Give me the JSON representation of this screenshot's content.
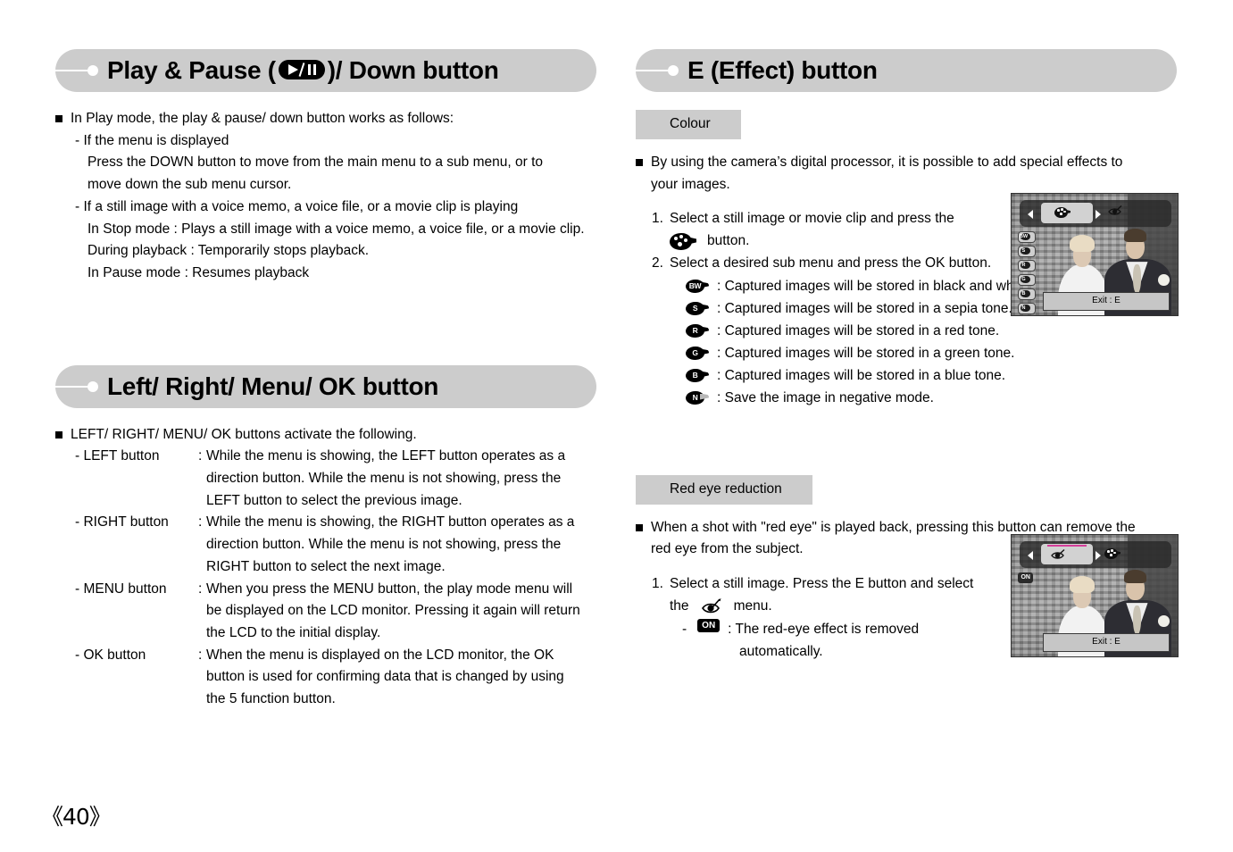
{
  "page": {
    "number": "《40》",
    "background": "#ffffff",
    "heading_fill": "#cccccc",
    "caption_fill": "#cccccc"
  },
  "left_column": {
    "section1": {
      "title_before": "Play & Pause (",
      "icon": "play-pause-icon",
      "title_after": ")/ Down button",
      "bullets": [
        {
          "marker": "square",
          "text": "In Play mode, the play & pause/ down button works as follows:"
        }
      ],
      "lines": [
        "- If the menu is displayed",
        "Press the DOWN button to move from the main menu to a sub menu, or to",
        "move down the sub menu cursor.",
        "- If a still image with a voice memo, a voice file, or a movie clip is playing",
        "In Stop mode : Plays a still image with a voice memo, a voice file, or a movie clip.",
        "During playback : Temporarily stops playback.",
        "In Pause mode : Resumes playback"
      ]
    },
    "section2": {
      "title": "Left/ Right/ Menu/ OK button",
      "bullet": "LEFT/ RIGHT/ MENU/ OK buttons activate the following.",
      "definitions": [
        {
          "label": "- LEFT button",
          "colon": ":",
          "lines": [
            "While the menu is showing, the LEFT button operates as a",
            "direction button. While the menu is not showing, press the",
            "LEFT button to select the previous image."
          ]
        },
        {
          "label": "- RIGHT button",
          "colon": ":",
          "lines": [
            "While the menu is showing, the RIGHT button operates as a",
            "direction button. While the menu is not showing, press the",
            "RIGHT button to select the next image."
          ]
        },
        {
          "label": "- MENU button",
          "colon": ":",
          "lines": [
            "When you press the MENU button, the play mode menu will",
            "be displayed on the LCD monitor. Pressing it again will return",
            "the LCD to the initial display."
          ]
        },
        {
          "label": "- OK button",
          "colon": ":",
          "lines": [
            "When the menu is displayed on the LCD monitor, the OK",
            "button is used for confirming data that is changed by using",
            "the 5 function button."
          ]
        }
      ]
    }
  },
  "right_column": {
    "section1": {
      "title": "E (Effect) button",
      "caption": "Colour",
      "bullet_lines": [
        "By using the camera’s digital processor, it is possible to add special effects to",
        "your images."
      ],
      "steps": [
        {
          "num": "1.",
          "line1": "Select a still image or movie clip and press the",
          "icon": "palette-icon",
          "line2": "button."
        },
        {
          "num": "2.",
          "line1": "Select a desired sub menu and press the OK button."
        }
      ],
      "effects": [
        {
          "badge": "BW",
          "icon": "effect-bw-icon",
          "text": ": Captured images will be stored in black and white."
        },
        {
          "badge": "S",
          "icon": "effect-sepia-icon",
          "text": ": Captured images will be stored in a sepia tone."
        },
        {
          "badge": "R",
          "icon": "effect-red-icon",
          "text": ": Captured images will be stored in a red tone."
        },
        {
          "badge": "G",
          "icon": "effect-green-icon",
          "text": ": Captured images will be stored in a green tone."
        },
        {
          "badge": "B",
          "icon": "effect-blue-icon",
          "text": ": Captured images will be stored in a blue tone."
        },
        {
          "badge": "N",
          "icon": "effect-negative-icon",
          "text": ": Save the image in negative mode."
        }
      ],
      "lcd": {
        "exit_label": "Exit : E",
        "side_badges": [
          "BW",
          "S",
          "R",
          "G",
          "B",
          "N"
        ]
      }
    },
    "section2": {
      "caption": "Red eye reduction",
      "bullet_lines": [
        "When a shot with \"red eye\" is played back, pressing this button can remove the",
        "red eye from the subject."
      ],
      "steps": [
        {
          "num": "1.",
          "line1": "Select a still image. Press the E button and select",
          "line2_prefix": "the",
          "icon": "red-eye-icon",
          "line2_suffix": "menu."
        }
      ],
      "sub": {
        "dash": "-",
        "badge": "ON",
        "text1": ": The red-eye effect is removed",
        "text2": "automatically."
      },
      "lcd": {
        "exit_label": "Exit : E",
        "on_tag": "ON"
      }
    }
  }
}
